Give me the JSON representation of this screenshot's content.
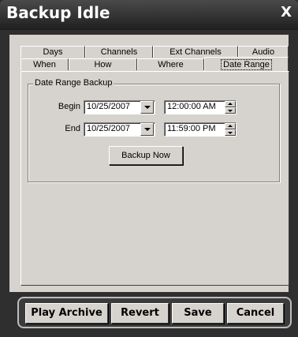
{
  "window": {
    "title": "Backup Idle",
    "close_label": "X"
  },
  "tabs": {
    "row1": [
      "Days",
      "Channels",
      "Ext Channels",
      "Audio"
    ],
    "row2": [
      "When",
      "How",
      "Where",
      "Date Range"
    ],
    "active": "Date Range"
  },
  "date_range": {
    "group_label": "Date Range Backup",
    "begin": {
      "label": "Begin",
      "date": "10/25/2007",
      "time": "12:00:00 AM"
    },
    "end": {
      "label": "End",
      "date": "10/25/2007",
      "time": "11:59:00 PM"
    },
    "backup_now_label": "Backup Now"
  },
  "footer": {
    "play_archive": "Play Archive",
    "revert": "Revert",
    "save": "Save",
    "cancel": "Cancel"
  }
}
